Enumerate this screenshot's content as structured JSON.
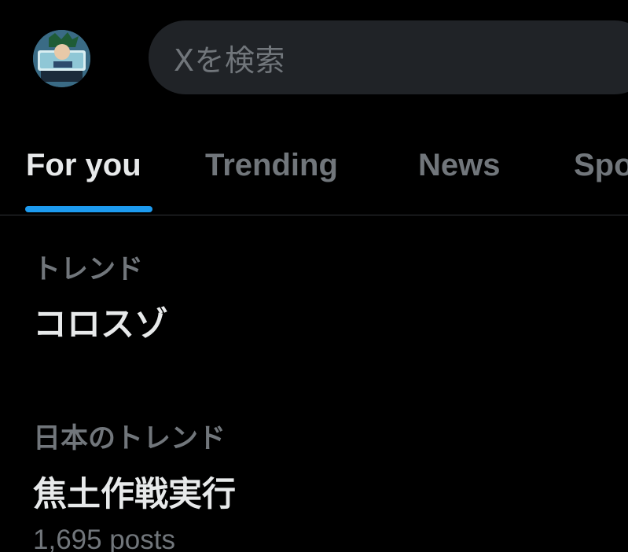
{
  "header": {
    "search": {
      "placeholder": "Xを検索"
    }
  },
  "tabs": [
    {
      "label": "For you",
      "active": true
    },
    {
      "label": "Trending",
      "active": false
    },
    {
      "label": "News",
      "active": false
    },
    {
      "label": "Spo",
      "active": false
    }
  ],
  "trends": [
    {
      "context": "トレンド",
      "title": "コロスゾ"
    },
    {
      "context": "日本のトレンド",
      "title": "焦土作戦実行",
      "posts": "1,695 posts"
    }
  ],
  "colors": {
    "background": "#000000",
    "text_primary": "#e7e9ea",
    "text_secondary": "#71767b",
    "accent": "#1d9bf0",
    "search_bg": "#202327",
    "divider": "#2f3336"
  }
}
